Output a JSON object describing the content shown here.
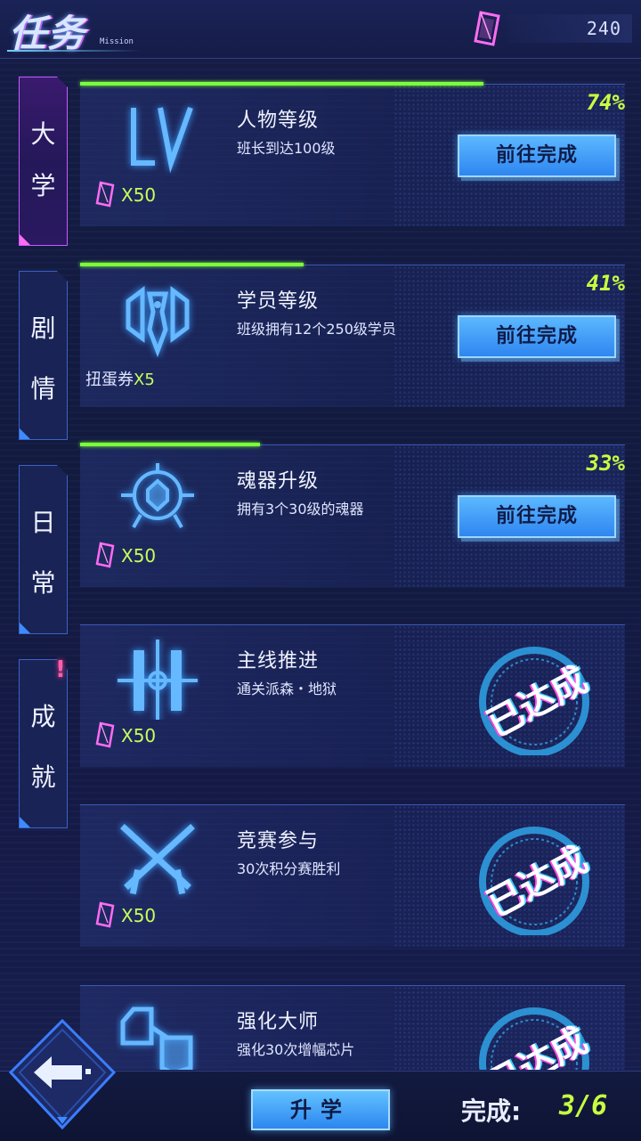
{
  "header": {
    "title": "任务",
    "subtitle": "Mission",
    "currency_icon": "purple-crystal-icon",
    "currency_amount": "240"
  },
  "tabs": [
    {
      "label": "大学",
      "active": true
    },
    {
      "label": "剧情",
      "active": false
    },
    {
      "label": "日常",
      "active": false
    },
    {
      "label": "成就",
      "active": false,
      "notice": "!"
    }
  ],
  "tasks": [
    {
      "icon": "level-lv-icon",
      "name": "人物等级",
      "desc": "班长到达100级",
      "reward": "X50",
      "reward_icon": "purple-crystal-icon",
      "progress": "74%",
      "progress_value": 0.74,
      "button": "前往完成",
      "status": "in-progress"
    },
    {
      "icon": "student-emblem-icon",
      "name": "学员等级",
      "desc": "班级拥有12个250级学员",
      "reward_item": "扭蛋券",
      "reward": "X5",
      "progress": "41%",
      "progress_value": 0.41,
      "button": "前往完成",
      "status": "in-progress"
    },
    {
      "icon": "soul-weapon-icon",
      "name": "魂器升级",
      "desc": "拥有3个30级的魂器",
      "reward": "X50",
      "reward_icon": "purple-crystal-icon",
      "progress": "33%",
      "progress_value": 0.33,
      "button": "前往完成",
      "status": "in-progress"
    },
    {
      "icon": "crosshair-icon",
      "name": "主线推进",
      "desc": "通关派森・地狱",
      "reward": "X50",
      "reward_icon": "purple-crystal-icon",
      "stamp": "已达成",
      "status": "done"
    },
    {
      "icon": "crossed-guns-icon",
      "name": "竞赛参与",
      "desc": "30次积分赛胜利",
      "reward": "X50",
      "reward_icon": "purple-crystal-icon",
      "stamp": "已达成",
      "status": "done"
    },
    {
      "icon": "chip-icon",
      "name": "强化大师",
      "desc": "强化30次增幅芯片",
      "stamp": "已达成",
      "status": "done"
    }
  ],
  "footer": {
    "back_icon": "back-arrow-icon",
    "upgrade_label": "升学",
    "complete_label": "完成:",
    "complete_value": "3/6"
  },
  "colors": {
    "accent_green": "#c8ff40",
    "button_blue": "#2e86f0",
    "tab_active": "#c45cff",
    "background": "#111a3d"
  }
}
